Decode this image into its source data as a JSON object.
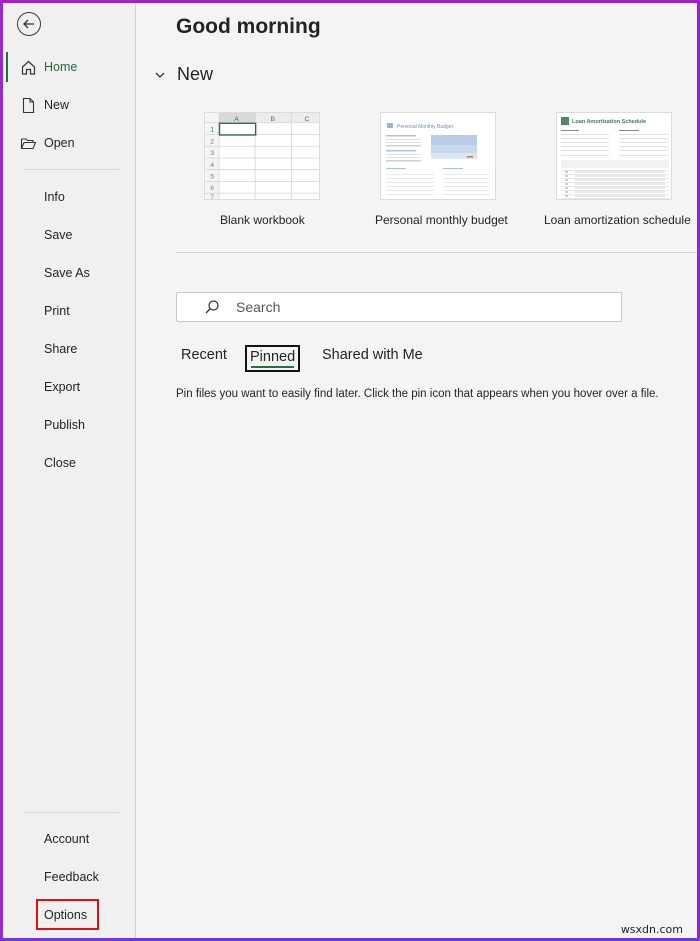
{
  "sidebar": {
    "back_label": "Back",
    "top_items": [
      {
        "label": "Home",
        "icon": "home-icon",
        "active": true
      },
      {
        "label": "New",
        "icon": "new-document-icon",
        "active": false
      },
      {
        "label": "Open",
        "icon": "open-folder-icon",
        "active": false
      }
    ],
    "file_items": [
      {
        "label": "Info"
      },
      {
        "label": "Save"
      },
      {
        "label": "Save As"
      },
      {
        "label": "Print"
      },
      {
        "label": "Share"
      },
      {
        "label": "Export"
      },
      {
        "label": "Publish"
      },
      {
        "label": "Close"
      }
    ],
    "bottom_items": [
      {
        "label": "Account"
      },
      {
        "label": "Feedback"
      },
      {
        "label": "Options",
        "highlighted": true
      }
    ]
  },
  "main": {
    "greeting": "Good morning",
    "new_section": {
      "title": "New",
      "templates": [
        {
          "label": "Blank workbook",
          "columns": [
            "A",
            "B",
            "C"
          ],
          "rows": [
            "1",
            "2",
            "3",
            "4",
            "5",
            "6",
            "7"
          ]
        },
        {
          "label": "Personal monthly budget",
          "preview_title": "Personal Monthly Budget"
        },
        {
          "label": "Loan amortization schedule",
          "preview_title": "Loan Amortization Schedule"
        }
      ]
    },
    "search": {
      "placeholder": "Search",
      "value": ""
    },
    "tabs": [
      {
        "label": "Recent",
        "selected": false
      },
      {
        "label": "Pinned",
        "selected": true
      },
      {
        "label": "Shared with Me",
        "selected": false
      }
    ],
    "pinned_hint": "Pin files you want to easily find later. Click the pin icon that appears when you hover over a file."
  },
  "watermark": "wsxdn.com",
  "colors": {
    "accent_green": "#217346",
    "highlight_red": "#e01010",
    "frame_purple": "#a020c8"
  }
}
